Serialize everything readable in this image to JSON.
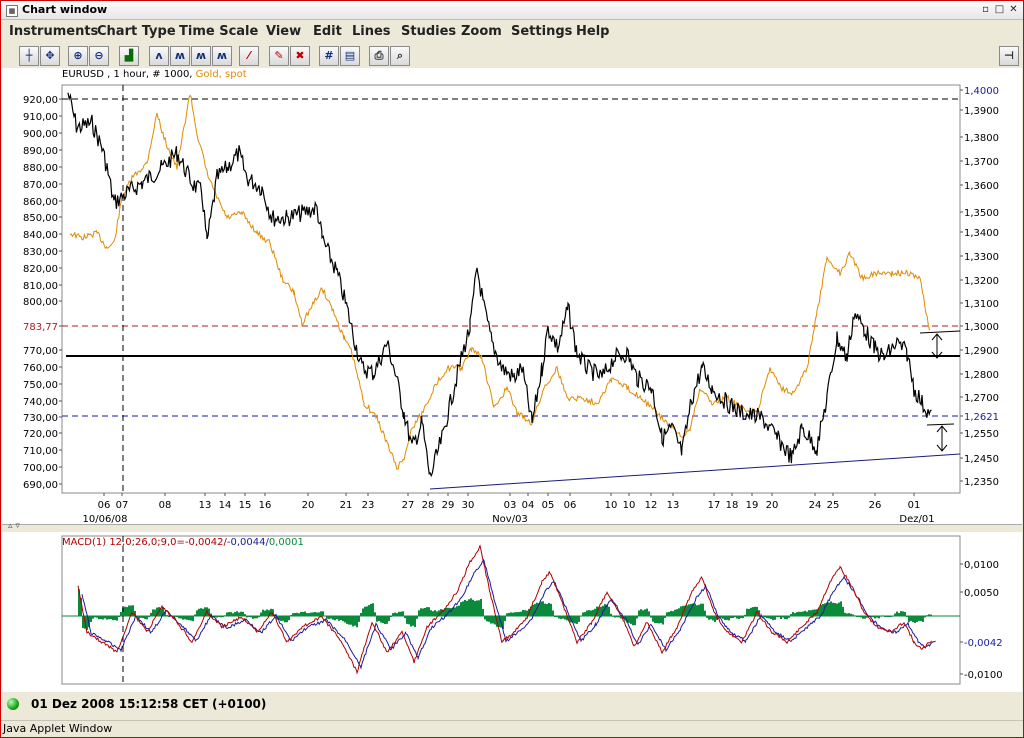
{
  "window": {
    "title": "Chart window",
    "restore_glyph": "▫",
    "maximize_glyph": "□",
    "close_glyph": "✕"
  },
  "menu": {
    "items": [
      "Instruments",
      "Chart Type",
      "Time Scale",
      "View",
      "Edit",
      "Lines",
      "Studies",
      "Zoom",
      "Settings",
      "Help"
    ]
  },
  "toolbar": {
    "buttons": [
      "crosshair-icon",
      "hand-cursor-icon",
      "zoom-in-icon",
      "zoom-out-icon",
      "bar-chart-icon",
      "line-chart-1-icon",
      "line-chart-2-icon",
      "line-chart-3-icon",
      "line-chart-4-icon",
      "trendline-icon",
      "pencil-icon",
      "delete-icon",
      "grid-icon",
      "grid-settings-icon",
      "print-icon",
      "print-preview-icon",
      "pin-icon"
    ]
  },
  "chart": {
    "legend_symbol": "EURUSD , 1 hour, # 1000, ",
    "legend_compare": "Gold, spot",
    "colors": {
      "eurusd": "#000000",
      "gold": "#e08a00",
      "macd": "#c00000",
      "signal": "#1a1aa0",
      "histogram": "#0a8a3a",
      "dashed_red": "#aa2020",
      "dashed_blue": "#1a1aa0"
    },
    "left_axis_labels": [
      "920,00",
      "910,00",
      "900,00",
      "890,00",
      "880,00",
      "870,00",
      "860,00",
      "850,00",
      "840,00",
      "830,00",
      "820,00",
      "810,00",
      "800,00",
      "783,77",
      "770,00",
      "760,00",
      "750,00",
      "740,00",
      "730,00",
      "720,00",
      "710,00",
      "700,00",
      "690,00"
    ],
    "right_axis_labels": [
      "1,4000",
      "1,3900",
      "1,3800",
      "1,3700",
      "1,3600",
      "1,3500",
      "1,3400",
      "1,3300",
      "1,3200",
      "1,3100",
      "1,3000",
      "1,2900",
      "1,2800",
      "1,2700",
      "1,2621",
      "1,2550",
      "1,2450",
      "1,2350"
    ],
    "x_tick_labels": [
      "06",
      "07",
      "08",
      "13",
      "14",
      "15",
      "16",
      "20",
      "21",
      "23",
      "27",
      "28",
      "29",
      "30",
      "03",
      "04",
      "05",
      "06",
      "10",
      "10",
      "12",
      "13",
      "17",
      "18",
      "19",
      "20",
      "24",
      "25",
      "26",
      "01"
    ],
    "x_sub_labels": [
      "10/06/08",
      "Nov/03",
      "Dez/01"
    ],
    "macd_legend_main": "MACD(1) 12,0;26,0;9,0=-0,0042/",
    "macd_legend_signal": "-0,0044/",
    "macd_legend_hist": "0,0001",
    "macd_axis_labels": [
      "0,0100",
      "0,0050",
      "-0,0042",
      "-0,0100"
    ]
  },
  "status": {
    "datetime": "01 Dez 2008 15:12:58  CET (+0100)"
  },
  "applet": {
    "label": "Java Applet Window"
  }
}
